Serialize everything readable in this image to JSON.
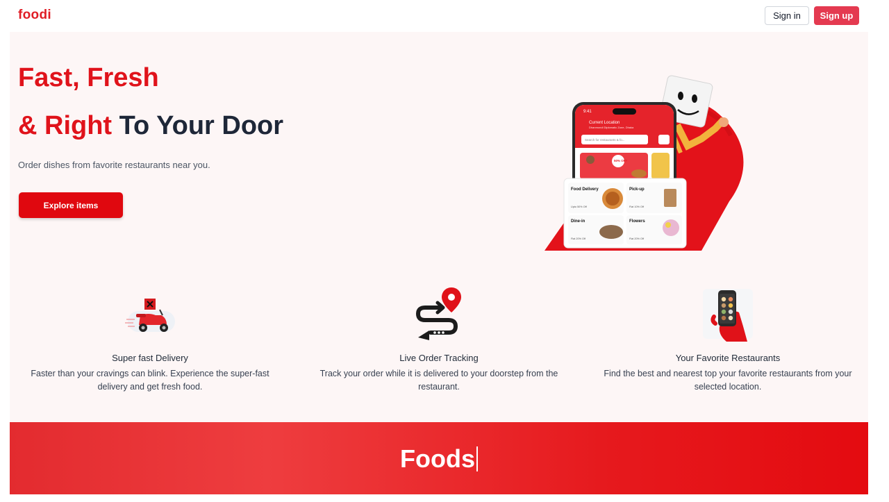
{
  "header": {
    "logo": "foodi",
    "signin_label": "Sign in",
    "signup_label": "Sign up"
  },
  "hero": {
    "title_line1": "Fast, Fresh",
    "title_line2_accent": "& Right",
    "title_line2_rest": " To Your Door",
    "subtitle": "Order dishes from favorite restaurants near you.",
    "cta_label": "Explore items",
    "phone": {
      "time": "9:41",
      "location_label": "Current Location",
      "location_value": "Dhanmondi Diplomatic Zone, Dhaka",
      "search_placeholder": "Search for restaurants & fo...",
      "promo_badge": "50% OFF",
      "cards": [
        {
          "title": "Food Delivery",
          "desc": "Best offers on your loved items",
          "tag": "Upto 50% Off"
        },
        {
          "title": "Pick-up",
          "desc": "Simply by yourself in 15 mins",
          "tag": "Flat 10% Off"
        },
        {
          "title": "Dine-in",
          "desc": "Let's Dine out",
          "tag": "Flat 20% Off"
        },
        {
          "title": "Flowers",
          "desc": "We deliver flowers",
          "tag": "Flat 20% Off"
        }
      ]
    }
  },
  "features": [
    {
      "icon": "scooter-delivery-icon",
      "title": "Super fast Delivery",
      "desc": "Faster than your cravings can blink. Experience the super-fast delivery and get fresh food."
    },
    {
      "icon": "route-tracking-icon",
      "title": "Live Order Tracking",
      "desc": "Track your order while it is delivered to your doorstep from the restaurant."
    },
    {
      "icon": "phone-in-hand-icon",
      "title": "Your Favorite Restaurants",
      "desc": "Find the best and nearest top your favorite restaurants from your selected location."
    }
  ],
  "banner": {
    "title": "Foods"
  },
  "colors": {
    "brand_red": "#e0131b",
    "signup_bg": "#e43a50",
    "hero_bg": "#fdf6f6",
    "heading_dark": "#1e2738"
  }
}
